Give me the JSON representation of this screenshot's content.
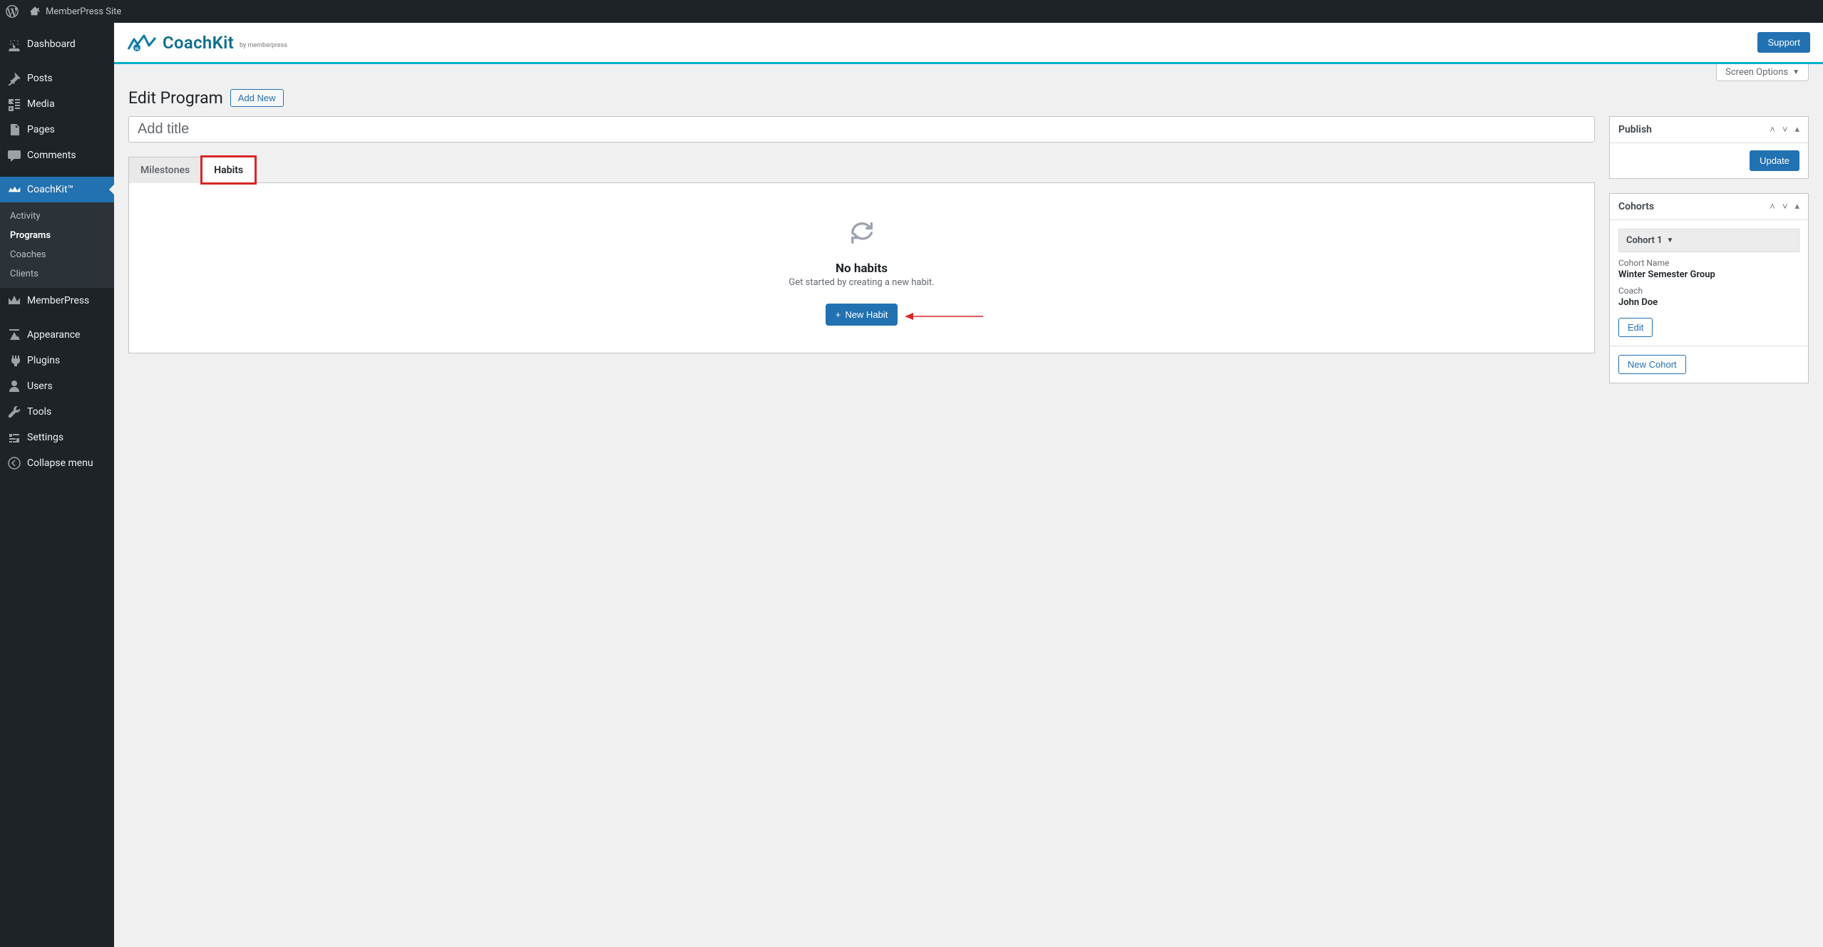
{
  "adminbar": {
    "site_name": "MemberPress Site"
  },
  "sidebar": {
    "items": [
      {
        "label": "Dashboard",
        "icon": "dashboard"
      },
      {
        "label": "Posts",
        "icon": "pin"
      },
      {
        "label": "Media",
        "icon": "media"
      },
      {
        "label": "Pages",
        "icon": "pages"
      },
      {
        "label": "Comments",
        "icon": "comments"
      },
      {
        "label": "CoachKit™",
        "icon": "coachkit",
        "current": true
      },
      {
        "label": "MemberPress",
        "icon": "memberpress"
      },
      {
        "label": "Appearance",
        "icon": "appearance"
      },
      {
        "label": "Plugins",
        "icon": "plugins"
      },
      {
        "label": "Users",
        "icon": "users"
      },
      {
        "label": "Tools",
        "icon": "tools"
      },
      {
        "label": "Settings",
        "icon": "settings"
      },
      {
        "label": "Collapse menu",
        "icon": "collapse"
      }
    ],
    "coachkit_submenu": [
      {
        "label": "Activity"
      },
      {
        "label": "Programs",
        "current": true
      },
      {
        "label": "Coaches"
      },
      {
        "label": "Clients"
      }
    ]
  },
  "brandbar": {
    "logo_text": "CoachKit",
    "logo_sub": "by memberpress",
    "support_label": "Support"
  },
  "screen_options_label": "Screen Options",
  "heading": {
    "title": "Edit Program",
    "add_new_label": "Add New"
  },
  "editor": {
    "title_placeholder": "Add title"
  },
  "tabs": {
    "milestones_label": "Milestones",
    "habits_label": "Habits",
    "active": "habits"
  },
  "empty_state": {
    "title": "No habits",
    "subtitle": "Get started by creating a new habit.",
    "new_habit_label": "New Habit"
  },
  "publish_box": {
    "title": "Publish",
    "update_label": "Update"
  },
  "cohorts_box": {
    "title": "Cohorts",
    "selected_cohort": "Cohort  1",
    "name_label": "Cohort Name",
    "name_value": "Winter Semester Group",
    "coach_label": "Coach",
    "coach_value": "John Doe",
    "edit_label": "Edit",
    "new_cohort_label": "New Cohort"
  }
}
